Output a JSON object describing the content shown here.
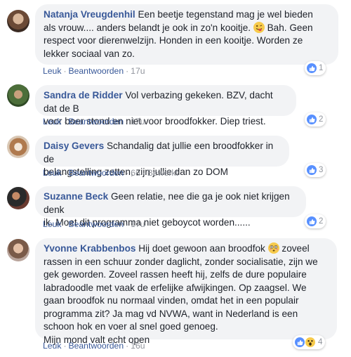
{
  "action_labels": {
    "like": "Leuk",
    "reply": "Beantwoorden",
    "edited": "Bewerkt"
  },
  "comments": [
    {
      "author": "Natanja Vreugdenhil",
      "text_lines": [
        "Een beetje tegenstand mag je wel bieden",
        "als vrouw.... anders belandt je ook in zo'n kooitje.",
        "respect voor dierenwelzijn. Honden in een kooitje. Worden ze",
        "lekker sociaal van zo."
      ],
      "inline_after_emoji": " Bah. Geen",
      "time": "17u",
      "reactions": "1"
    },
    {
      "author": "Sandra de Ridder",
      "text_lines": [
        "Vol verbazing gekeken. BZV, dacht dat de B",
        "voor boer stond en niet voor broodfokker. Diep triest."
      ],
      "time": "17u",
      "reactions": "2"
    },
    {
      "author": "Daisy Gevers",
      "text_lines": [
        "Schandalig dat jullie een broodfokker in de",
        "belangstelling zetten, zijn jullie dan zo DOM"
      ],
      "time": "6u",
      "reactions": "3"
    },
    {
      "author": "Suzanne Beck",
      "text_lines": [
        "Geen relatie, nee die ga je ook niet krijgen denk",
        "ik. Moet dit programma niet geboycot worden......"
      ],
      "time": "17u",
      "reactions": "2"
    },
    {
      "author": "Yvonne Krabbenbos",
      "text_lines": [
        "Hij doet gewoon aan broodfok",
        "zoveel",
        "rassen in een schuur zonder daglicht, zonder socialisatie, zijn we",
        "gek geworden. Zoveel rassen heeft hij, zelfs de dure populaire",
        "labradoodle met vaak de erfelijke afwijkingen. Op zaagsel. We",
        "gaan broodfok nu normaal vinden, omdat het in een populair",
        "programma zit? Ja mag vd NVWA, want in Nederland is een",
        "schoon hok en voer al snel goed genoeg.",
        "Mijn mond valt echt open"
      ],
      "time": "16u",
      "reactions": "4"
    }
  ],
  "colors": {
    "name": "#385898",
    "bubble": "#f2f3f5",
    "meta": "#90949c",
    "like": "#5890ff",
    "wow": "#f7cb4c"
  }
}
